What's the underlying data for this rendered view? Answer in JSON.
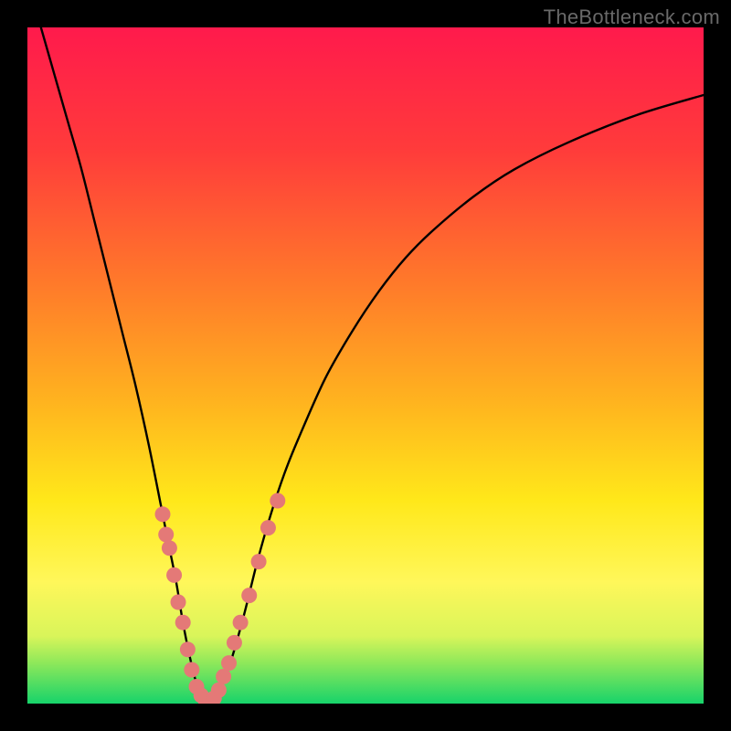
{
  "watermark": "TheBottleneck.com",
  "colors": {
    "frame": "#000000",
    "curve": "#000000",
    "markers": "#e47977",
    "gradient_stops": [
      {
        "offset": 0.0,
        "color": "#ff1a4c"
      },
      {
        "offset": 0.18,
        "color": "#ff3b3b"
      },
      {
        "offset": 0.38,
        "color": "#ff7a2a"
      },
      {
        "offset": 0.55,
        "color": "#ffb21f"
      },
      {
        "offset": 0.7,
        "color": "#ffe81a"
      },
      {
        "offset": 0.82,
        "color": "#fff75a"
      },
      {
        "offset": 0.9,
        "color": "#d9f55a"
      },
      {
        "offset": 0.94,
        "color": "#8ee85a"
      },
      {
        "offset": 1.0,
        "color": "#17d36a"
      }
    ]
  },
  "chart_data": {
    "type": "line",
    "title": "",
    "xlabel": "",
    "ylabel": "",
    "xlim": [
      0,
      100
    ],
    "ylim": [
      0,
      100
    ],
    "series": [
      {
        "name": "bottleneck-curve",
        "x": [
          2,
          4,
          6,
          8,
          10,
          12,
          14,
          16,
          18,
          20,
          21,
          22,
          23,
          24,
          25,
          26,
          27,
          28,
          30,
          32,
          34,
          36,
          38,
          40,
          44,
          48,
          52,
          56,
          60,
          66,
          72,
          80,
          90,
          100
        ],
        "y": [
          100,
          93,
          86,
          79,
          71,
          63,
          55,
          47,
          38,
          28,
          23,
          18,
          12,
          7,
          3,
          1,
          0.5,
          1,
          6,
          13,
          21,
          28,
          34,
          39,
          48,
          55,
          61,
          66,
          70,
          75,
          79,
          83,
          87,
          90
        ]
      }
    ],
    "marker_points": {
      "left": [
        {
          "x": 20.0,
          "y": 28
        },
        {
          "x": 20.5,
          "y": 25
        },
        {
          "x": 21.0,
          "y": 23
        },
        {
          "x": 21.7,
          "y": 19
        },
        {
          "x": 22.3,
          "y": 15
        },
        {
          "x": 23.0,
          "y": 12
        },
        {
          "x": 23.7,
          "y": 8
        },
        {
          "x": 24.3,
          "y": 5
        },
        {
          "x": 25.0,
          "y": 2.5
        },
        {
          "x": 25.7,
          "y": 1.2
        },
        {
          "x": 26.3,
          "y": 0.6
        },
        {
          "x": 27.0,
          "y": 0.5
        }
      ],
      "right": [
        {
          "x": 27.6,
          "y": 0.8
        },
        {
          "x": 28.3,
          "y": 2
        },
        {
          "x": 29.0,
          "y": 4
        },
        {
          "x": 29.8,
          "y": 6
        },
        {
          "x": 30.6,
          "y": 9
        },
        {
          "x": 31.5,
          "y": 12
        },
        {
          "x": 32.8,
          "y": 16
        },
        {
          "x": 34.2,
          "y": 21
        },
        {
          "x": 35.6,
          "y": 26
        },
        {
          "x": 37.0,
          "y": 30
        }
      ]
    }
  }
}
